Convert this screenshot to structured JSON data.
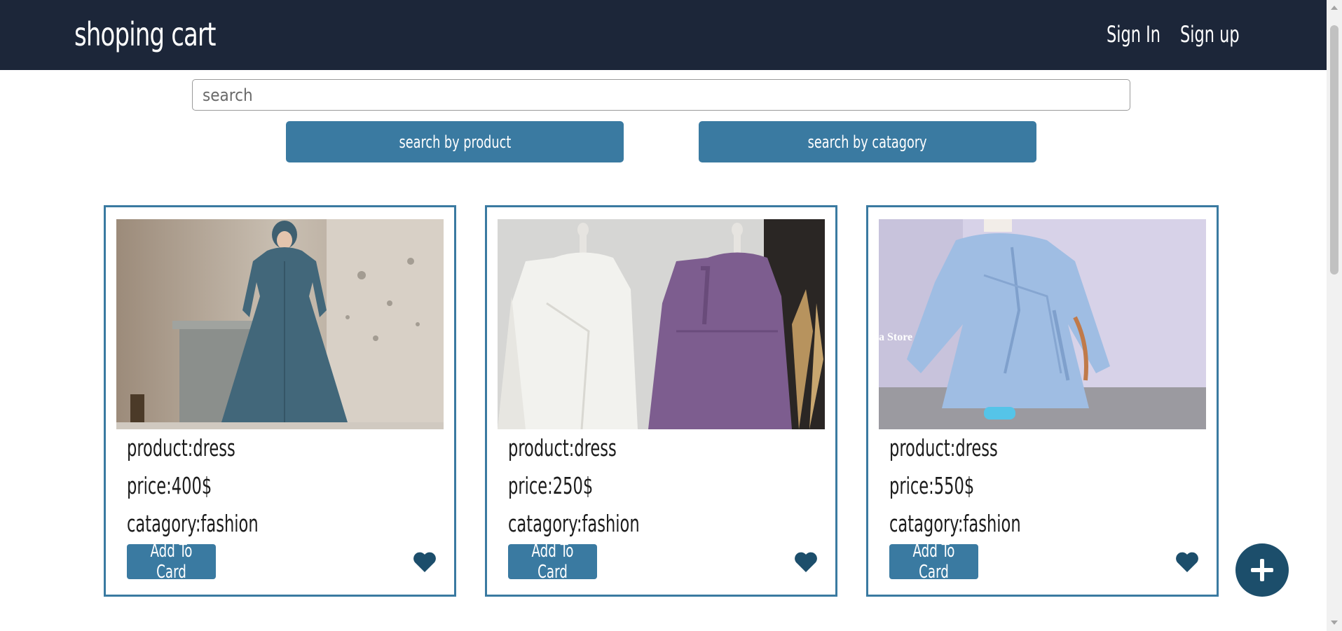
{
  "navbar": {
    "brand": "shoping cart",
    "links": [
      "Sign In",
      "Sign up"
    ]
  },
  "search": {
    "placeholder": "search",
    "value": "",
    "buttons": [
      "search by product",
      "search by catagory"
    ]
  },
  "products": [
    {
      "product_label": "product:dress",
      "price_label": "price:400$",
      "category_label": "catagory:fashion",
      "button": "Add To Card",
      "image": "teal-blue long dress"
    },
    {
      "product_label": "product:dress",
      "price_label": "price:250$",
      "category_label": "catagory:fashion",
      "button": "Add To Card",
      "image": "white and purple dresses on mannequins"
    },
    {
      "product_label": "product:dress",
      "price_label": "price:550$",
      "category_label": "catagory:fashion",
      "button": "Add To Card",
      "image": "light blue wrap dress",
      "image_text": "a Store"
    }
  ],
  "icons": {
    "favorite": "heart-icon",
    "add": "plus-icon"
  },
  "colors": {
    "navbar": "#1c2639",
    "accent": "#3a7aa1",
    "fab": "#1c4e6b",
    "heart": "#1c4e6b"
  }
}
